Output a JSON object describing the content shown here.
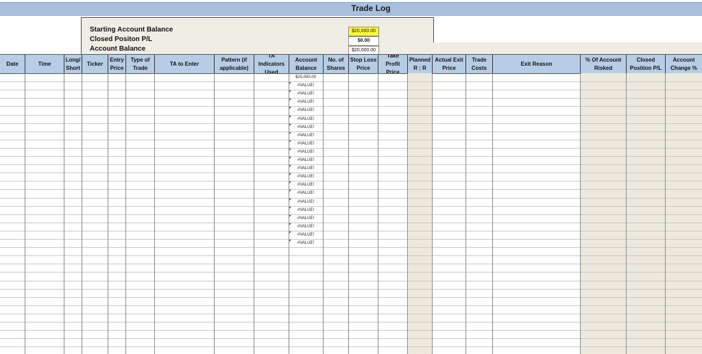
{
  "title": "Trade Log",
  "summary": {
    "starting_label": "Starting Account Balance",
    "starting_value": "$20,000.00",
    "closed_label": "Closed Positon P/L",
    "closed_value": "$0.00",
    "balance_label": "Account Balance",
    "balance_value": "$20,000.00"
  },
  "columns": [
    "Date",
    "Time",
    "Long/ Short",
    "Ticker",
    "Entry Price",
    "Type of Trade",
    "TA to Enter",
    "Pattern (if applicable)",
    "TA Indicators Used",
    "Account Balance",
    "No. of Shares",
    "Stop Loss Price",
    "Take Profit Price",
    "Planned R : R",
    "Actual Exit Price",
    "Trade Costs",
    "Exit Reason",
    "% Of Account Risked",
    "Closed Position P/L",
    "Account Change %"
  ],
  "account_balance_column": [
    "$20,000.00",
    "#VALUE!",
    "#VALUE!",
    "#VALUE!",
    "#VALUE!",
    "#VALUE!",
    "#VALUE!",
    "#VALUE!",
    "#VALUE!",
    "#VALUE!",
    "#VALUE!",
    "#VALUE!",
    "#VALUE!",
    "#VALUE!",
    "#VALUE!",
    "#VALUE!",
    "#VALUE!",
    "#VALUE!",
    "#VALUE!",
    "#VALUE!",
    "#VALUE!"
  ],
  "colors": {
    "title_bar": "#a8c0de",
    "header": "#b7cde6",
    "summary_bg": "#efede4",
    "highlight": "#ffff33",
    "shaded_column": "#ede9dd"
  }
}
